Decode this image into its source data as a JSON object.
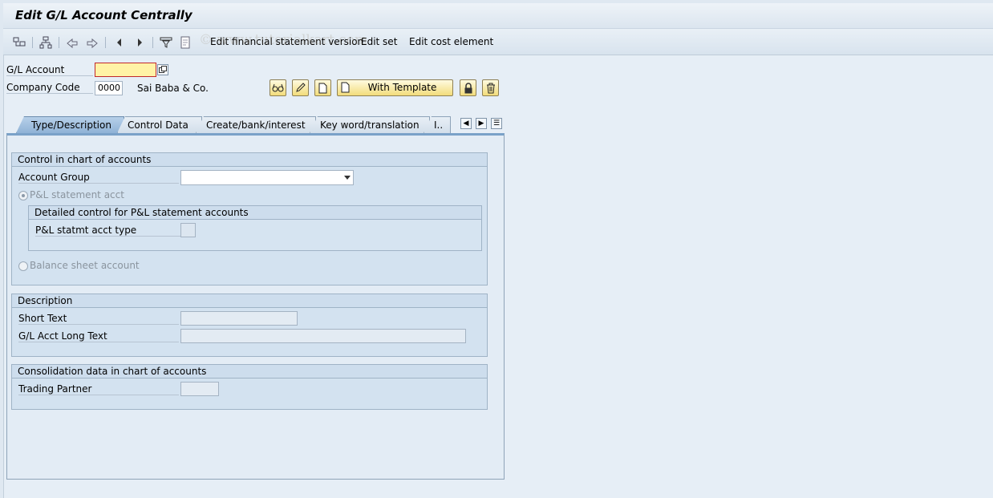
{
  "title": "Edit G/L Account Centrally",
  "toolbar": {
    "links": [
      "Edit financial statement version",
      "Edit set",
      "Edit cost element"
    ],
    "icons": [
      "hierarchy-icon",
      "document-tree-icon",
      "back-icon",
      "forward-icon",
      "previous-icon",
      "next-icon",
      "filter-icon",
      "info-icon"
    ]
  },
  "watermark": "© www.tutorialkart.com",
  "header": {
    "gl_account_label": "G/L Account",
    "gl_account_value": "",
    "company_code_label": "Company Code",
    "company_code_value": "0000",
    "company_name": "Sai Baba & Co.",
    "with_template_label": "With Template"
  },
  "tabs": [
    {
      "label": "Type/Description",
      "active": true
    },
    {
      "label": "Control Data",
      "active": false
    },
    {
      "label": "Create/bank/interest",
      "active": false
    },
    {
      "label": "Key word/translation",
      "active": false
    },
    {
      "label": "I..",
      "active": false
    }
  ],
  "control": {
    "heading": "Control in chart of accounts",
    "account_group_label": "Account Group",
    "account_group_value": "",
    "pl_statement_label": "P&L statement acct",
    "detailed_heading": "Detailed control for P&L statement accounts",
    "pl_type_label": "P&L statmt acct type",
    "balance_sheet_label": "Balance sheet account"
  },
  "description": {
    "heading": "Description",
    "short_text_label": "Short Text",
    "long_text_label": "G/L Acct Long Text"
  },
  "consolidation": {
    "heading": "Consolidation data in chart of accounts",
    "trading_partner_label": "Trading Partner"
  },
  "colors": {
    "required_field": "#fff3a6",
    "active_tab": "#8fb2d6",
    "button": "#f2dc7b"
  }
}
